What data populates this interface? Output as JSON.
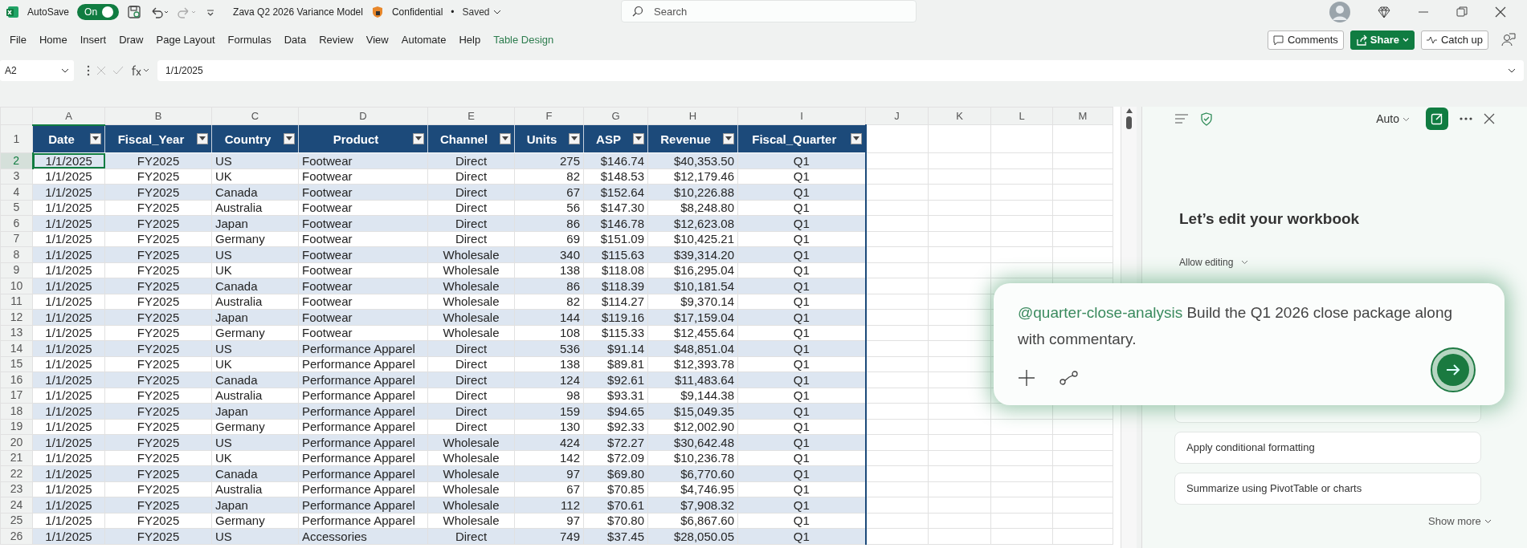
{
  "title_bar": {
    "autosave_label": "AutoSave",
    "autosave": {
      "label": "On",
      "on": true
    },
    "document_title": "Zava Q2 2026 Variance Model",
    "sensitivity": "Confidential",
    "separator": "•",
    "save_status": "Saved",
    "search": {
      "placeholder": "Search"
    }
  },
  "ribbon": {
    "tabs": [
      {
        "label": "File",
        "kind": "normal"
      },
      {
        "label": "Home",
        "kind": "normal"
      },
      {
        "label": "Insert",
        "kind": "normal"
      },
      {
        "label": "Draw",
        "kind": "normal"
      },
      {
        "label": "Page Layout",
        "kind": "normal"
      },
      {
        "label": "Formulas",
        "kind": "normal"
      },
      {
        "label": "Data",
        "kind": "normal"
      },
      {
        "label": "Review",
        "kind": "normal"
      },
      {
        "label": "View",
        "kind": "normal"
      },
      {
        "label": "Automate",
        "kind": "normal"
      },
      {
        "label": "Help",
        "kind": "normal"
      },
      {
        "label": "Table Design",
        "kind": "contextual"
      }
    ],
    "actions": [
      {
        "label": "Comments",
        "kind": "outline"
      },
      {
        "label": "Share",
        "kind": "primary"
      },
      {
        "label": "Catch up",
        "kind": "outline"
      }
    ]
  },
  "formula_bar": {
    "name_box": "A2",
    "value": "1/1/2025"
  },
  "sheet": {
    "column_letters": [
      {
        "label": "A",
        "selected": true
      },
      {
        "label": "B",
        "selected": false
      },
      {
        "label": "C",
        "selected": false
      },
      {
        "label": "D",
        "selected": false
      },
      {
        "label": "E",
        "selected": false
      },
      {
        "label": "F",
        "selected": false
      },
      {
        "label": "G",
        "selected": false
      },
      {
        "label": "H",
        "selected": false
      },
      {
        "label": "I",
        "selected": false
      },
      {
        "label": "J",
        "selected": false
      },
      {
        "label": "K",
        "selected": false
      },
      {
        "label": "L",
        "selected": false
      },
      {
        "label": "M",
        "selected": false
      }
    ],
    "header_row_number": "1",
    "columns": [
      {
        "label": "Date",
        "kind": "centered"
      },
      {
        "label": "Fiscal_Year",
        "kind": "centered"
      },
      {
        "label": "Country",
        "kind": "text"
      },
      {
        "label": "Product",
        "kind": "text"
      },
      {
        "label": "Channel",
        "kind": "centered"
      },
      {
        "label": "Units",
        "kind": "numeric"
      },
      {
        "label": "ASP",
        "kind": "numeric"
      },
      {
        "label": "Revenue",
        "kind": "numeric"
      },
      {
        "label": "Fiscal_Quarter",
        "kind": "centered"
      }
    ],
    "rows": [
      {
        "number": "2",
        "selected": true,
        "cells": [
          "1/1/2025",
          "FY2025",
          "US",
          "Footwear",
          "Direct",
          "275",
          "$146.74",
          "$40,353.50",
          "Q1"
        ]
      },
      {
        "number": "3",
        "selected": false,
        "cells": [
          "1/1/2025",
          "FY2025",
          "UK",
          "Footwear",
          "Direct",
          "82",
          "$148.53",
          "$12,179.46",
          "Q1"
        ]
      },
      {
        "number": "4",
        "selected": false,
        "cells": [
          "1/1/2025",
          "FY2025",
          "Canada",
          "Footwear",
          "Direct",
          "67",
          "$152.64",
          "$10,226.88",
          "Q1"
        ]
      },
      {
        "number": "5",
        "selected": false,
        "cells": [
          "1/1/2025",
          "FY2025",
          "Australia",
          "Footwear",
          "Direct",
          "56",
          "$147.30",
          "$8,248.80",
          "Q1"
        ]
      },
      {
        "number": "6",
        "selected": false,
        "cells": [
          "1/1/2025",
          "FY2025",
          "Japan",
          "Footwear",
          "Direct",
          "86",
          "$146.78",
          "$12,623.08",
          "Q1"
        ]
      },
      {
        "number": "7",
        "selected": false,
        "cells": [
          "1/1/2025",
          "FY2025",
          "Germany",
          "Footwear",
          "Direct",
          "69",
          "$151.09",
          "$10,425.21",
          "Q1"
        ]
      },
      {
        "number": "8",
        "selected": false,
        "cells": [
          "1/1/2025",
          "FY2025",
          "US",
          "Footwear",
          "Wholesale",
          "340",
          "$115.63",
          "$39,314.20",
          "Q1"
        ]
      },
      {
        "number": "9",
        "selected": false,
        "cells": [
          "1/1/2025",
          "FY2025",
          "UK",
          "Footwear",
          "Wholesale",
          "138",
          "$118.08",
          "$16,295.04",
          "Q1"
        ]
      },
      {
        "number": "10",
        "selected": false,
        "cells": [
          "1/1/2025",
          "FY2025",
          "Canada",
          "Footwear",
          "Wholesale",
          "86",
          "$118.39",
          "$10,181.54",
          "Q1"
        ]
      },
      {
        "number": "11",
        "selected": false,
        "cells": [
          "1/1/2025",
          "FY2025",
          "Australia",
          "Footwear",
          "Wholesale",
          "82",
          "$114.27",
          "$9,370.14",
          "Q1"
        ]
      },
      {
        "number": "12",
        "selected": false,
        "cells": [
          "1/1/2025",
          "FY2025",
          "Japan",
          "Footwear",
          "Wholesale",
          "144",
          "$119.16",
          "$17,159.04",
          "Q1"
        ]
      },
      {
        "number": "13",
        "selected": false,
        "cells": [
          "1/1/2025",
          "FY2025",
          "Germany",
          "Footwear",
          "Wholesale",
          "108",
          "$115.33",
          "$12,455.64",
          "Q1"
        ]
      },
      {
        "number": "14",
        "selected": false,
        "cells": [
          "1/1/2025",
          "FY2025",
          "US",
          "Performance Apparel",
          "Direct",
          "536",
          "$91.14",
          "$48,851.04",
          "Q1"
        ]
      },
      {
        "number": "15",
        "selected": false,
        "cells": [
          "1/1/2025",
          "FY2025",
          "UK",
          "Performance Apparel",
          "Direct",
          "138",
          "$89.81",
          "$12,393.78",
          "Q1"
        ]
      },
      {
        "number": "16",
        "selected": false,
        "cells": [
          "1/1/2025",
          "FY2025",
          "Canada",
          "Performance Apparel",
          "Direct",
          "124",
          "$92.61",
          "$11,483.64",
          "Q1"
        ]
      },
      {
        "number": "17",
        "selected": false,
        "cells": [
          "1/1/2025",
          "FY2025",
          "Australia",
          "Performance Apparel",
          "Direct",
          "98",
          "$93.31",
          "$9,144.38",
          "Q1"
        ]
      },
      {
        "number": "18",
        "selected": false,
        "cells": [
          "1/1/2025",
          "FY2025",
          "Japan",
          "Performance Apparel",
          "Direct",
          "159",
          "$94.65",
          "$15,049.35",
          "Q1"
        ]
      },
      {
        "number": "19",
        "selected": false,
        "cells": [
          "1/1/2025",
          "FY2025",
          "Germany",
          "Performance Apparel",
          "Direct",
          "130",
          "$92.33",
          "$12,002.90",
          "Q1"
        ]
      },
      {
        "number": "20",
        "selected": false,
        "cells": [
          "1/1/2025",
          "FY2025",
          "US",
          "Performance Apparel",
          "Wholesale",
          "424",
          "$72.27",
          "$30,642.48",
          "Q1"
        ]
      },
      {
        "number": "21",
        "selected": false,
        "cells": [
          "1/1/2025",
          "FY2025",
          "UK",
          "Performance Apparel",
          "Wholesale",
          "142",
          "$72.09",
          "$10,236.78",
          "Q1"
        ]
      },
      {
        "number": "22",
        "selected": false,
        "cells": [
          "1/1/2025",
          "FY2025",
          "Canada",
          "Performance Apparel",
          "Wholesale",
          "97",
          "$69.80",
          "$6,770.60",
          "Q1"
        ]
      },
      {
        "number": "23",
        "selected": false,
        "cells": [
          "1/1/2025",
          "FY2025",
          "Australia",
          "Performance Apparel",
          "Wholesale",
          "67",
          "$70.85",
          "$4,746.95",
          "Q1"
        ]
      },
      {
        "number": "24",
        "selected": false,
        "cells": [
          "1/1/2025",
          "FY2025",
          "Japan",
          "Performance Apparel",
          "Wholesale",
          "112",
          "$70.61",
          "$7,908.32",
          "Q1"
        ]
      },
      {
        "number": "25",
        "selected": false,
        "cells": [
          "1/1/2025",
          "FY2025",
          "Germany",
          "Performance Apparel",
          "Wholesale",
          "97",
          "$70.80",
          "$6,867.60",
          "Q1"
        ]
      },
      {
        "number": "26",
        "selected": false,
        "cells": [
          "1/1/2025",
          "FY2025",
          "US",
          "Accessories",
          "Direct",
          "749",
          "$37.45",
          "$28,050.05",
          "Q1"
        ]
      }
    ]
  },
  "assistant_pane": {
    "mode": "Auto",
    "heading": "Let’s edit your workbook",
    "permission": "Allow editing",
    "prompt": {
      "mention": "@quarter-close-analysis",
      "text": "Build the Q1 2026 close package along with commentary."
    },
    "suggestions": [
      {
        "label": "Apply conditional formatting"
      },
      {
        "label": "Summarize using PivotTable or charts"
      }
    ],
    "show_more": "Show more"
  }
}
